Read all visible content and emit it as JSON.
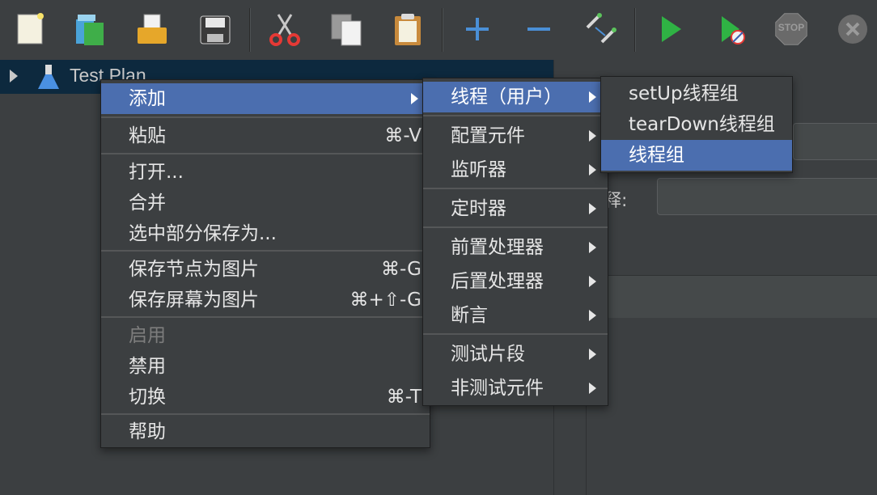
{
  "toolbar": {
    "buttons": [
      {
        "icon": "new-document-icon"
      },
      {
        "icon": "templates-icon"
      },
      {
        "icon": "open-folder-icon"
      },
      {
        "icon": "save-icon"
      },
      {
        "icon": "cut-icon"
      },
      {
        "icon": "copy-icon"
      },
      {
        "icon": "paste-icon"
      },
      {
        "icon": "expand-plus-icon"
      },
      {
        "icon": "collapse-minus-icon"
      },
      {
        "icon": "toggle-icon"
      },
      {
        "icon": "start-icon"
      },
      {
        "icon": "start-no-pauses-icon"
      },
      {
        "icon": "stop-icon"
      },
      {
        "icon": "shutdown-icon"
      }
    ],
    "stop_text": "STOP"
  },
  "tree": {
    "root_label": "Test Plan"
  },
  "right_panel": {
    "comment_label": "释:"
  },
  "context_menu": {
    "items": [
      {
        "label": "添加",
        "shortcut": "",
        "submenu": true
      },
      {
        "label": "粘贴",
        "shortcut": "⌘-V"
      },
      {
        "label": "打开...",
        "shortcut": ""
      },
      {
        "label": "合并",
        "shortcut": ""
      },
      {
        "label": "选中部分保存为...",
        "shortcut": ""
      },
      {
        "label": "保存节点为图片",
        "shortcut": "⌘-G"
      },
      {
        "label": "保存屏幕为图片",
        "shortcut": "⌘+⇧-G"
      },
      {
        "label": "启用",
        "shortcut": "",
        "disabled": true
      },
      {
        "label": "禁用",
        "shortcut": ""
      },
      {
        "label": "切换",
        "shortcut": "⌘-T"
      },
      {
        "label": "帮助",
        "shortcut": ""
      }
    ]
  },
  "add_submenu": {
    "items": [
      {
        "label": "线程（用户）"
      },
      {
        "label": "配置元件"
      },
      {
        "label": "监听器"
      },
      {
        "label": "定时器"
      },
      {
        "label": "前置处理器"
      },
      {
        "label": "后置处理器"
      },
      {
        "label": "断言"
      },
      {
        "label": "测试片段"
      },
      {
        "label": "非测试元件"
      }
    ]
  },
  "threads_submenu": {
    "items": [
      {
        "label": "setUp线程组"
      },
      {
        "label": "tearDown线程组"
      },
      {
        "label": "线程组"
      }
    ]
  },
  "colors": {
    "background": "#3c3f41",
    "selection": "#4b6eaf",
    "tree_selection": "#0d293e"
  }
}
